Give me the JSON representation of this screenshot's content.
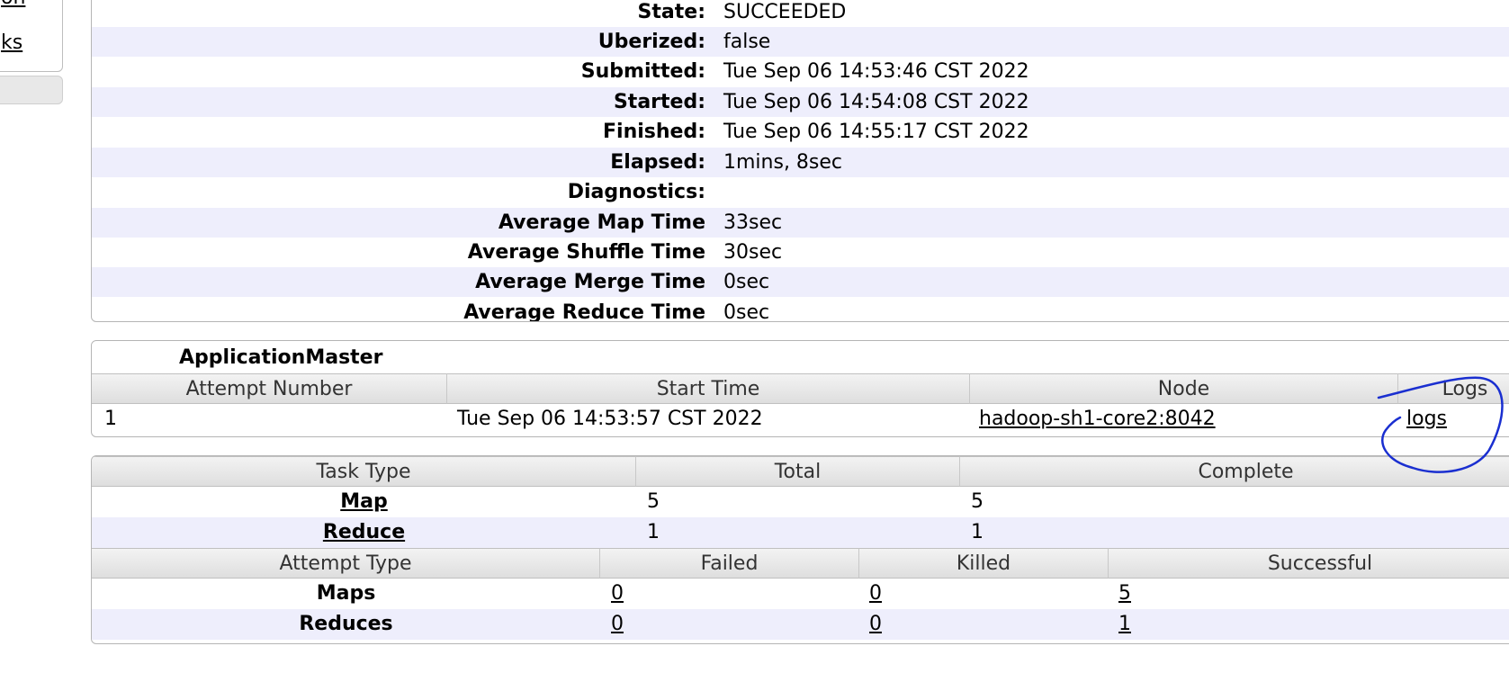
{
  "nav": {
    "link1": "on",
    "link2": "ks"
  },
  "overview": {
    "rows": [
      {
        "label": "State:",
        "value": "SUCCEEDED"
      },
      {
        "label": "Uberized:",
        "value": "false"
      },
      {
        "label": "Submitted:",
        "value": "Tue Sep 06 14:53:46 CST 2022"
      },
      {
        "label": "Started:",
        "value": "Tue Sep 06 14:54:08 CST 2022"
      },
      {
        "label": "Finished:",
        "value": "Tue Sep 06 14:55:17 CST 2022"
      },
      {
        "label": "Elapsed:",
        "value": "1mins, 8sec"
      },
      {
        "label": "Diagnostics:",
        "value": ""
      },
      {
        "label": "Average Map Time",
        "value": "33sec"
      },
      {
        "label": "Average Shuffle Time",
        "value": "30sec"
      },
      {
        "label": "Average Merge Time",
        "value": "0sec"
      },
      {
        "label": "Average Reduce Time",
        "value": "0sec"
      }
    ]
  },
  "app_master": {
    "caption": "ApplicationMaster",
    "headers": [
      "Attempt Number",
      "Start Time",
      "Node",
      "Logs"
    ],
    "row": {
      "attempt": "1",
      "start_time": "Tue Sep 06 14:53:57 CST 2022",
      "node": "hadoop-sh1-core2:8042",
      "logs": "logs"
    }
  },
  "task_summary": {
    "headers": [
      "Task Type",
      "Total",
      "Complete"
    ],
    "rows": [
      {
        "type": "Map",
        "total": "5",
        "complete": "5"
      },
      {
        "type": "Reduce",
        "total": "1",
        "complete": "1"
      }
    ]
  },
  "attempt_summary": {
    "headers": [
      "Attempt Type",
      "Failed",
      "Killed",
      "Successful"
    ],
    "rows": [
      {
        "type": "Maps",
        "failed": "0",
        "killed": "0",
        "successful": "5"
      },
      {
        "type": "Reduces",
        "failed": "0",
        "killed": "0",
        "successful": "1"
      }
    ]
  },
  "colors": {
    "alt_row": "#eeeefc",
    "annotation": "#1a2fd0"
  }
}
